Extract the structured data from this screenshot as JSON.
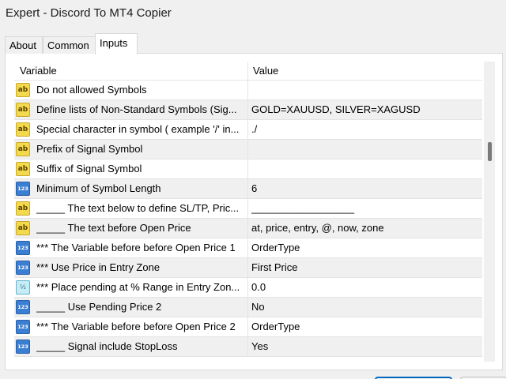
{
  "window": {
    "title": "Expert - Discord To MT4 Copier"
  },
  "tabs": [
    {
      "label": "About"
    },
    {
      "label": "Common"
    },
    {
      "label": "Inputs"
    }
  ],
  "grid": {
    "columns": [
      "Variable",
      "Value"
    ],
    "rows": [
      {
        "icon": "ab",
        "variable": "Do not allowed Symbols",
        "value": ""
      },
      {
        "icon": "ab",
        "variable": "Define lists of Non-Standard Symbols (Sig...",
        "value": "GOLD=XAUUSD, SILVER=XAGUSD"
      },
      {
        "icon": "ab",
        "variable": "Special character in symbol ( example '/' in...",
        "value": "./"
      },
      {
        "icon": "ab",
        "variable": "Prefix of Signal Symbol",
        "value": ""
      },
      {
        "icon": "ab",
        "variable": "Suffix of Signal Symbol",
        "value": ""
      },
      {
        "icon": "123",
        "variable": "Minimum of Symbol Length",
        "value": "6"
      },
      {
        "icon": "ab",
        "variable": "_____ The text below to define SL/TP, Pric...",
        "value": "__________________"
      },
      {
        "icon": "ab",
        "variable": "_____ The text before Open Price",
        "value": "at, price, entry, @, now, zone"
      },
      {
        "icon": "123",
        "variable": "*** The Variable before before Open Price 1",
        "value": "OrderType"
      },
      {
        "icon": "123",
        "variable": "*** Use Price in Entry Zone",
        "value": "First Price"
      },
      {
        "icon": "1/2",
        "variable": "*** Place pending at % Range in Entry Zon...",
        "value": "0.0"
      },
      {
        "icon": "123",
        "variable": "_____ Use Pending Price 2",
        "value": "No"
      },
      {
        "icon": "123",
        "variable": "*** The Variable before before Open Price 2",
        "value": "OrderType"
      },
      {
        "icon": "123",
        "variable": "_____ Signal include StopLoss",
        "value": "Yes"
      }
    ]
  }
}
